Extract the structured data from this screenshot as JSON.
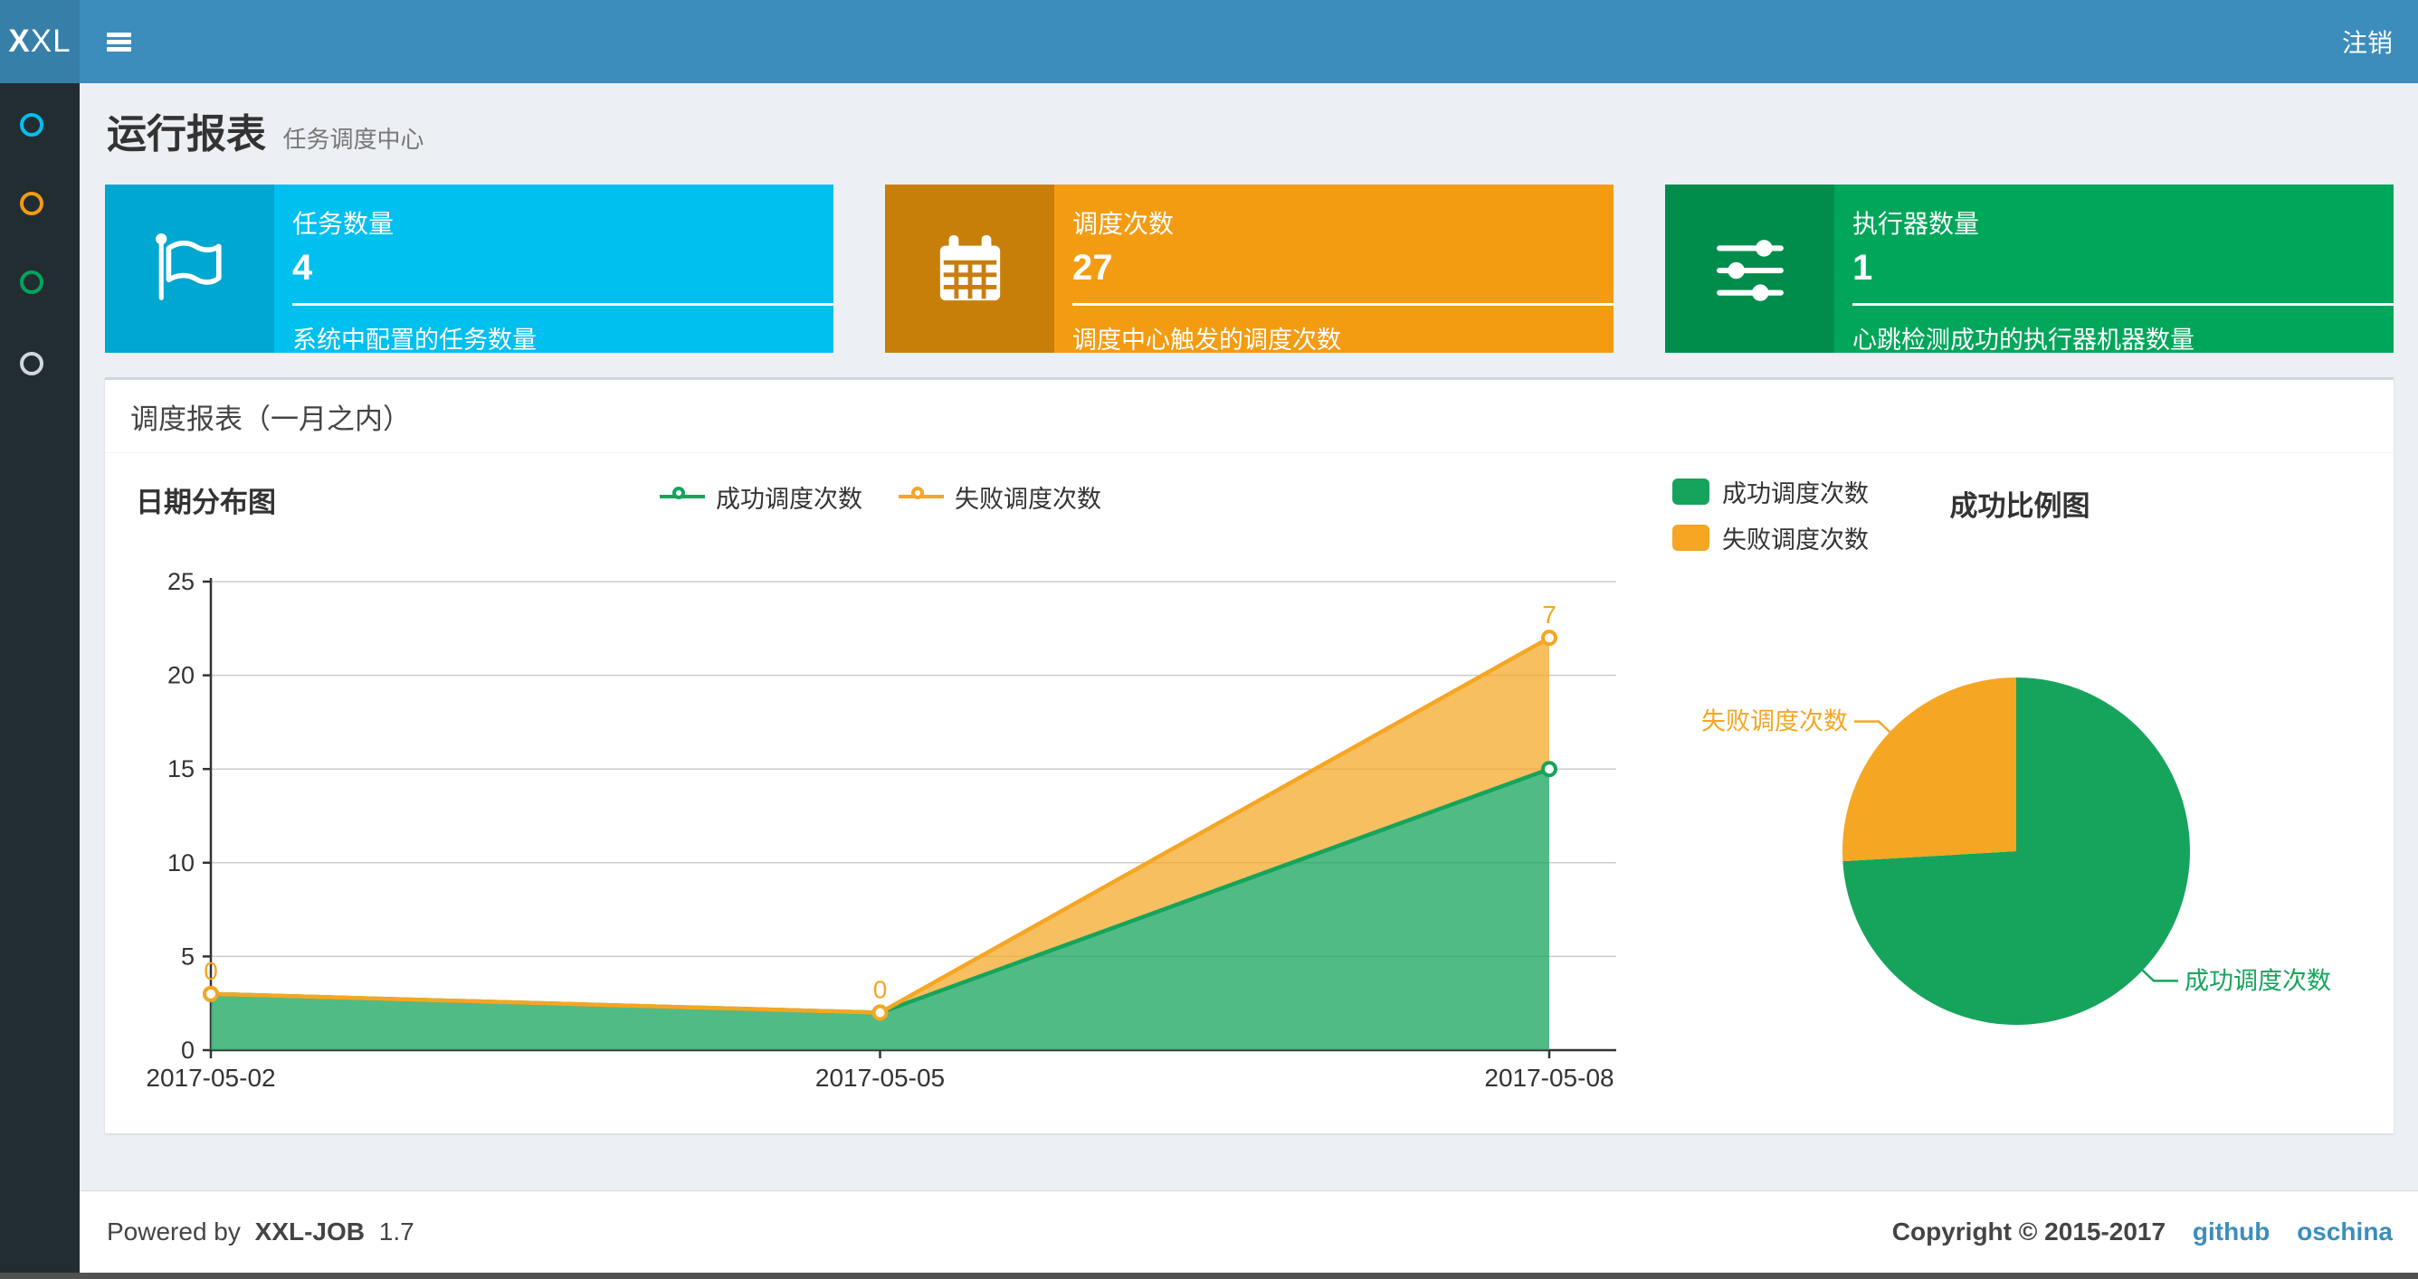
{
  "navbar": {
    "logo_bold": "X",
    "logo_rest": "XL",
    "logout": "注销"
  },
  "sidebar": {
    "items": [
      {
        "icon": "circle-icon",
        "color": "#00c0ef"
      },
      {
        "icon": "circle-icon",
        "color": "#f39c12"
      },
      {
        "icon": "circle-icon",
        "color": "#00a65a"
      },
      {
        "icon": "circle-icon",
        "color": "#d2d6de"
      }
    ]
  },
  "page": {
    "title": "运行报表",
    "subtitle": "任务调度中心"
  },
  "info_boxes": [
    {
      "label": "任务数量",
      "value": "4",
      "desc": "系统中配置的任务数量",
      "bg": "#00c0ef",
      "icon_bg": "#00a7d0",
      "icon": "flag-icon"
    },
    {
      "label": "调度次数",
      "value": "27",
      "desc": "调度中心触发的调度次数",
      "bg": "#f39c12",
      "icon_bg": "#c87f0a",
      "icon": "calendar-icon"
    },
    {
      "label": "执行器数量",
      "value": "1",
      "desc": "心跳检测成功的执行器机器数量",
      "bg": "#00a65a",
      "icon_bg": "#008d4c",
      "icon": "sliders-icon"
    }
  ],
  "panel": {
    "title": "调度报表（一月之内）"
  },
  "chart_data": [
    {
      "type": "area",
      "name": "日期分布图",
      "stacked": true,
      "categories": [
        "2017-05-02",
        "2017-05-05",
        "2017-05-08"
      ],
      "series": [
        {
          "name": "成功调度次数",
          "values": [
            3,
            2,
            15
          ],
          "color": "#16a45c"
        },
        {
          "name": "失败调度次数",
          "values": [
            0,
            0,
            7
          ],
          "color": "#f5a623",
          "point_labels": [
            "0",
            "0",
            "7"
          ]
        }
      ],
      "ylim": [
        0,
        25
      ],
      "yticks": [
        0,
        5,
        10,
        15,
        20,
        25
      ],
      "grid": true,
      "legend_position": "top-center"
    },
    {
      "type": "pie",
      "name": "成功比例图",
      "labels": [
        "成功调度次数",
        "失败调度次数"
      ],
      "values": [
        20,
        7
      ],
      "colors": [
        "#16a45c",
        "#f5a623"
      ],
      "legend_position": "top-left",
      "start_angle": "top",
      "direction": "clockwise-for-success"
    }
  ],
  "footer": {
    "powered_prefix": "Powered by",
    "product": "XXL-JOB",
    "version": "1.7",
    "copyright": "Copyright © 2015-2017",
    "links": [
      "github",
      "oschina"
    ]
  },
  "colors": {
    "navbar": "#3c8dbc",
    "logo_bg": "#367fa9",
    "sidebar_bg": "#222d32",
    "content_bg": "#ecf0f5",
    "axis": "#333333",
    "grid": "#cccccc",
    "link": "#3c8dbc"
  }
}
